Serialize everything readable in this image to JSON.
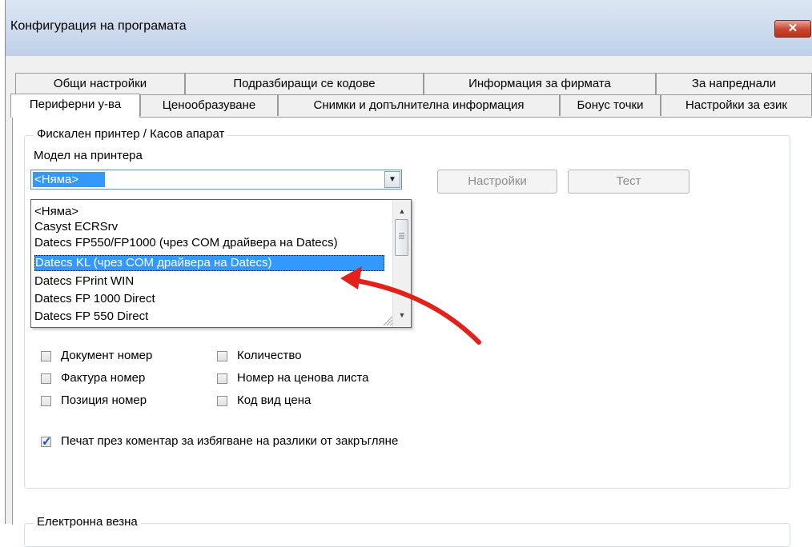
{
  "window": {
    "title": "Конфигурация на програмата",
    "close_label": "✕"
  },
  "tabs_row1": [
    "Общи настройки",
    "Подразбиращи се кодове",
    "Информация за фирмата",
    "За напреднали"
  ],
  "tabs_row2": [
    "Периферни у-ва",
    "Ценообразуване",
    "Снимки и допълнителна информация",
    "Бонус точки",
    "Настройки за език"
  ],
  "fiscal_group": {
    "legend": "Фискален принтер / Касов апарат",
    "model_label": "Модел на принтера",
    "combo_value": "<Няма>",
    "settings_button": "Настройки",
    "test_button": "Тест",
    "dropdown_items": [
      "<Няма>",
      "Casyst ECRSrv",
      "Datecs FP550/FP1000 (чрез COM драйвера на Datecs)",
      "Datecs KL (чрез COM драйвера на Datecs)",
      "Datecs FPrint WIN",
      "Datecs FP 1000 Direct",
      "Datecs FP 550 Direct"
    ],
    "selected_index": 3,
    "checkboxes": [
      {
        "label": "Документ номер",
        "checked": false
      },
      {
        "label": "Фактура номер",
        "checked": false
      },
      {
        "label": "Позиция номер",
        "checked": false
      },
      {
        "label": "Количество",
        "checked": false
      },
      {
        "label": "Номер на ценова листа",
        "checked": false
      },
      {
        "label": "Код вид цена",
        "checked": false
      }
    ],
    "comment_checkbox": {
      "label": "Печат през коментар за избягване на разлики от закръгляне",
      "checked": true
    }
  },
  "scale_group": {
    "legend": "Електронна везна"
  },
  "colors": {
    "selection": "#3399ff",
    "annotation_arrow": "#e3211c"
  }
}
